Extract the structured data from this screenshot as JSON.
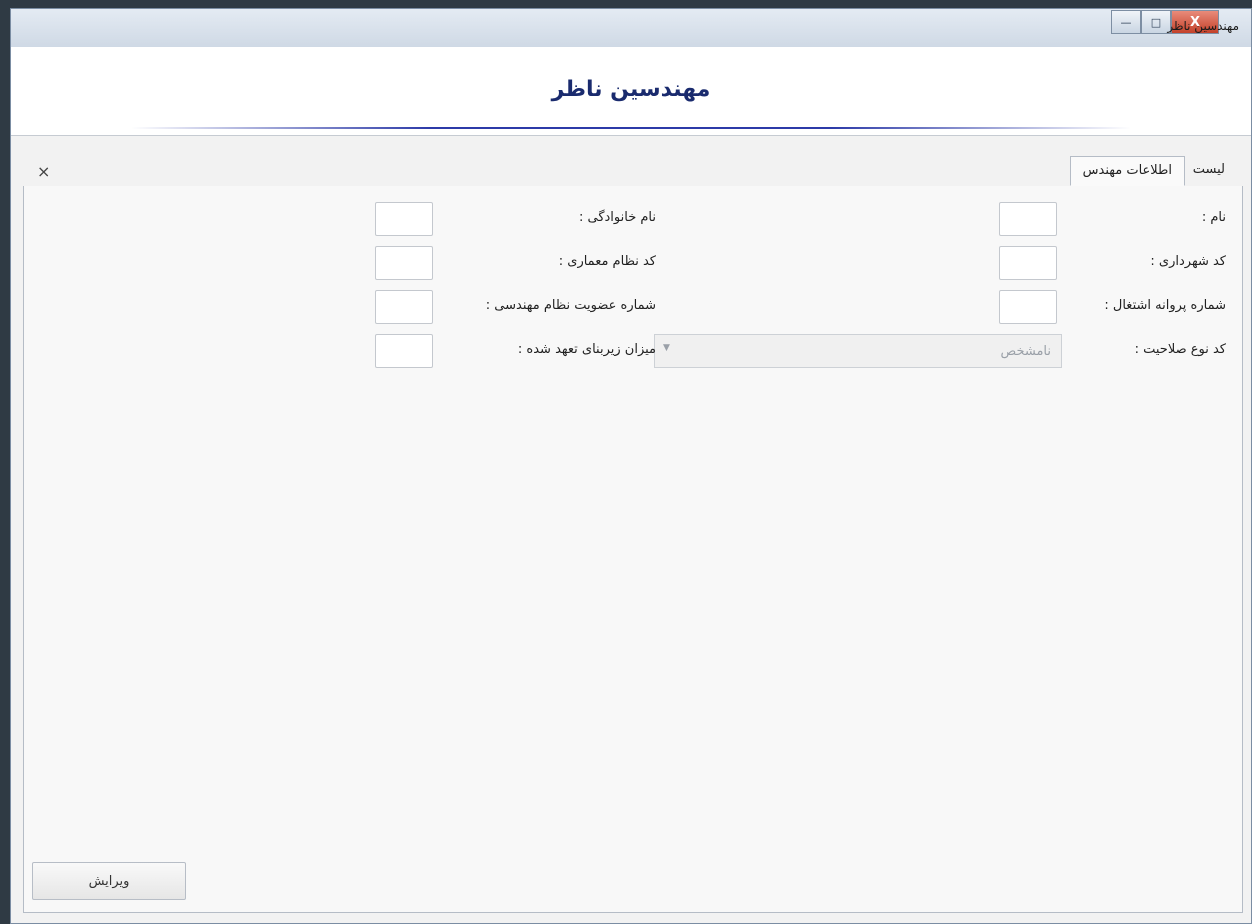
{
  "window": {
    "title": "مهندسین ناظر",
    "controls": {
      "minimize": "—",
      "maximize": "□",
      "close": "X"
    }
  },
  "header": {
    "title": "مهندسین ناظر"
  },
  "tabs": [
    {
      "label": "لیست",
      "active": false
    },
    {
      "label": "اطلاعات مهندس",
      "active": true
    }
  ],
  "tab_close": "×",
  "form": {
    "fields": {
      "first_name": {
        "label": "نام :",
        "value": ""
      },
      "last_name": {
        "label": "نام خانوادگی :",
        "value": ""
      },
      "municipality_code": {
        "label": "کد شهرداری :",
        "value": ""
      },
      "architecture_code": {
        "label": "کد نظام معماری :",
        "value": ""
      },
      "license_number": {
        "label": "شماره پروانه اشتغال :",
        "value": ""
      },
      "membership_number": {
        "label": "شماره عضویت نظام مهندسی :",
        "value": ""
      },
      "competency_code": {
        "label": "کد نوع صلاحیت :",
        "value": "نامشخص"
      },
      "committed_area": {
        "label": "میزان زیربنای تعهد شده :",
        "value": ""
      }
    }
  },
  "buttons": {
    "edit": "ویرایش"
  }
}
